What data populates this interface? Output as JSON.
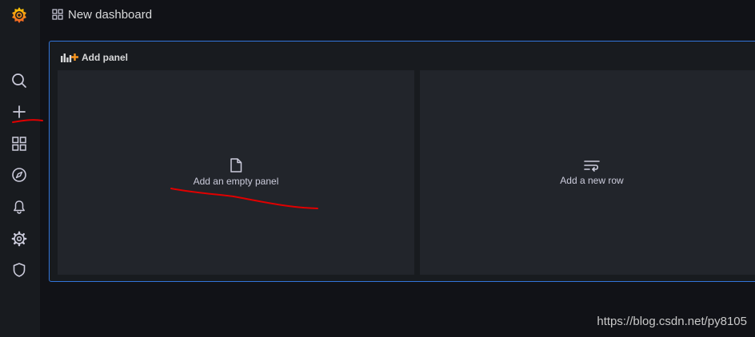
{
  "dashboard": {
    "title": "New dashboard"
  },
  "panel": {
    "title": "Add panel",
    "options": {
      "empty_panel": "Add an empty panel",
      "new_row": "Add a new row"
    }
  },
  "sidebar": {
    "items": [
      {
        "icon": "search-icon"
      },
      {
        "icon": "plus-icon"
      },
      {
        "icon": "dashboards-icon"
      },
      {
        "icon": "explore-icon"
      },
      {
        "icon": "bell-icon"
      },
      {
        "icon": "gear-icon"
      },
      {
        "icon": "shield-icon"
      }
    ]
  },
  "watermark": "https://blog.csdn.net/py8105",
  "colors": {
    "accent_border": "#3274d9",
    "logo_orange": "#f05a28",
    "annotation_red": "#e00000"
  }
}
